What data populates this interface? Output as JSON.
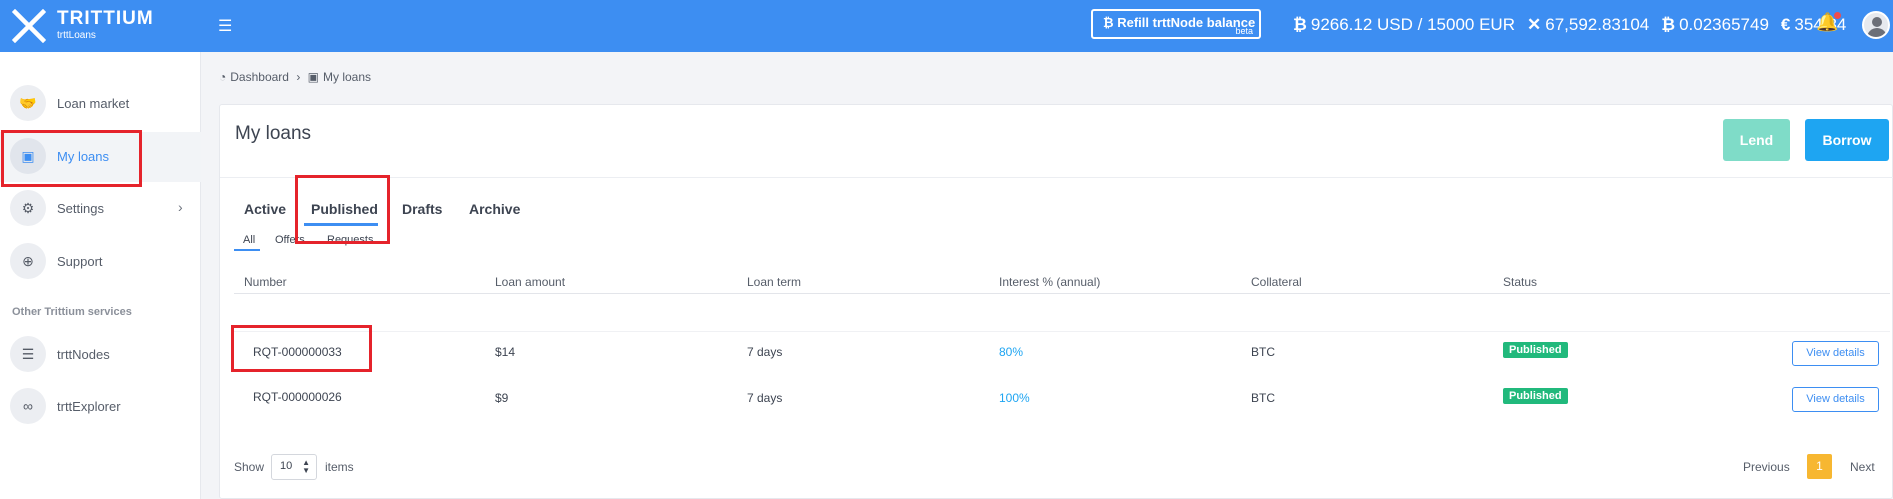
{
  "app": {
    "name": "TRITTIUM",
    "subtitle": "trttLoans"
  },
  "header": {
    "refill_label": "Refill trttNode balance",
    "refill_badge": "beta",
    "balances": [
      {
        "icon": "bitcoin-icon",
        "symbol": "₿",
        "value": "9266.12 USD / 15000 EUR"
      },
      {
        "icon": "trittium-icon",
        "symbol": "✕",
        "value": "67,592.83104"
      },
      {
        "icon": "bitcoin-icon",
        "symbol": "₿",
        "value": "0.02365749"
      },
      {
        "icon": "euro-icon",
        "symbol": "€",
        "value": "354.84"
      }
    ]
  },
  "sidebar": {
    "items": [
      {
        "label": "Loan market",
        "icon": "handshake-icon"
      },
      {
        "label": "My loans",
        "icon": "briefcase-icon"
      },
      {
        "label": "Settings",
        "icon": "gear-icon"
      },
      {
        "label": "Support",
        "icon": "lifebuoy-icon"
      }
    ],
    "section_title": "Other Trittium services",
    "services": [
      {
        "label": "trttNodes",
        "icon": "server-icon"
      },
      {
        "label": "trttExplorer",
        "icon": "link-icon"
      }
    ]
  },
  "breadcrumb": {
    "home": "Dashboard",
    "current": "My loans"
  },
  "main": {
    "title": "My loans",
    "lend_label": "Lend",
    "borrow_label": "Borrow",
    "tabs": [
      "Active",
      "Published",
      "Drafts",
      "Archive"
    ],
    "active_tab": "Published",
    "subtabs": [
      "All",
      "Offers",
      "Requests"
    ],
    "active_subtab": "All",
    "columns": [
      "Number",
      "Loan amount",
      "Loan term",
      "Interest % (annual)",
      "Collateral",
      "Status"
    ],
    "rows": [
      {
        "number": "RQT-000000033",
        "amount": "$14",
        "term": "7 days",
        "interest": "80%",
        "collateral": "BTC",
        "status": "Published",
        "action": "View details"
      },
      {
        "number": "RQT-000000026",
        "amount": "$9",
        "term": "7 days",
        "interest": "100%",
        "collateral": "BTC",
        "status": "Published",
        "action": "View details"
      }
    ],
    "pagination": {
      "show_label": "Show",
      "page_size": "10",
      "items_label": "items",
      "prev": "Previous",
      "current_page": "1",
      "next": "Next"
    }
  },
  "colors": {
    "primary": "#3d8ef2",
    "lend": "#7fdcc8",
    "borrow": "#1ea5f2",
    "published": "#21b97c",
    "page_active": "#f7b731",
    "highlight": "#e5232b"
  }
}
